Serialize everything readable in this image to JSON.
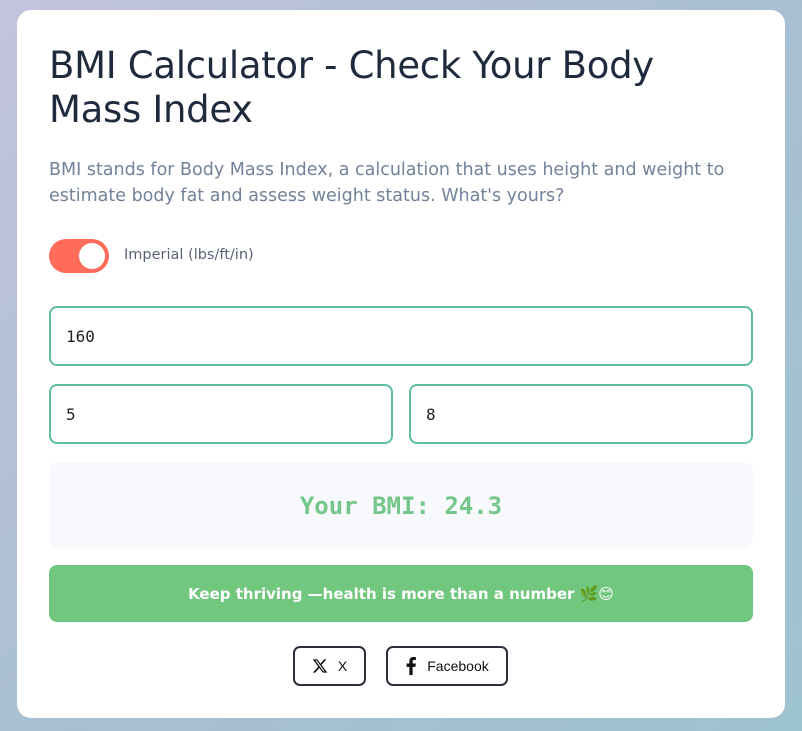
{
  "header": {
    "title": "BMI Calculator - Check Your Body Mass Index",
    "description": "BMI stands for Body Mass Index, a calculation that uses height and weight to estimate body fat and assess weight status. What's yours?"
  },
  "unit_toggle": {
    "label": "Imperial (lbs/ft/in)",
    "on": true,
    "color": "#ff6d5a"
  },
  "inputs": {
    "weight": "160",
    "height_feet": "5",
    "height_inches": "8",
    "border_color": "#5fbca5"
  },
  "result": {
    "text": "Your BMI: 24.3",
    "color": "#74c68a"
  },
  "message": {
    "text": "Keep thriving —health is more than a number 🌿😊",
    "color": "#72c77f"
  },
  "share": {
    "x_label": "X",
    "facebook_label": "Facebook"
  }
}
